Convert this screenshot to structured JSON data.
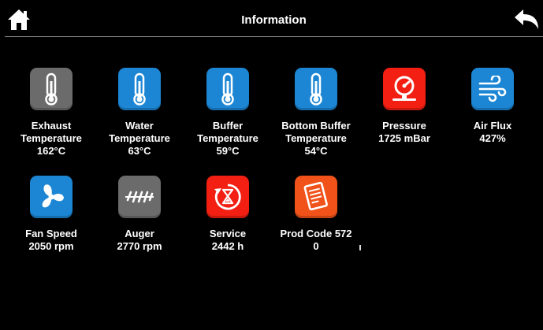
{
  "header": {
    "title": "Information",
    "home_icon": "home-icon",
    "back_icon": "back-arrow-icon"
  },
  "colors": {
    "gray": "#6b6b6b",
    "blue": "#1c86d4",
    "red": "#f21f12",
    "orange": "#f0521a"
  },
  "tiles": [
    {
      "name": "exhaust-temperature",
      "icon": "thermometer-icon",
      "color": "gray",
      "lines": [
        "Exhaust",
        "Temperature",
        "162°C"
      ]
    },
    {
      "name": "water-temperature",
      "icon": "thermometer-icon",
      "color": "blue",
      "lines": [
        "Water",
        "Temperature",
        "63°C"
      ]
    },
    {
      "name": "buffer-temperature",
      "icon": "thermometer-icon",
      "color": "blue",
      "lines": [
        "Buffer",
        "Temperature",
        "59°C"
      ]
    },
    {
      "name": "bottom-buffer-temperature",
      "icon": "thermometer-icon",
      "color": "blue",
      "lines": [
        "Bottom Buffer",
        "Temperature",
        "54°C"
      ]
    },
    {
      "name": "pressure",
      "icon": "pressure-gauge-icon",
      "color": "red",
      "lines": [
        "Pressure",
        "1725 mBar"
      ]
    },
    {
      "name": "air-flux",
      "icon": "wind-icon",
      "color": "blue",
      "lines": [
        "Air Flux",
        "427%"
      ]
    },
    {
      "name": "fan-speed",
      "icon": "fan-icon",
      "color": "blue",
      "lines": [
        "Fan Speed",
        "2050 rpm"
      ]
    },
    {
      "name": "auger",
      "icon": "auger-icon",
      "color": "gray",
      "lines": [
        "Auger",
        "2770 rpm"
      ]
    },
    {
      "name": "service",
      "icon": "service-hourglass-icon",
      "color": "red",
      "lines": [
        "Service",
        "2442 h"
      ]
    },
    {
      "name": "prod-code",
      "icon": "document-list-icon",
      "color": "orange",
      "lines": [
        "Prod Code 572",
        "0"
      ]
    }
  ]
}
